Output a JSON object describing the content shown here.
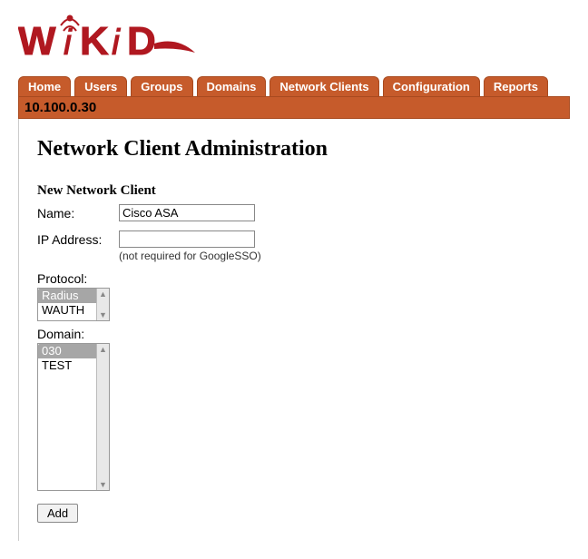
{
  "brand": {
    "name": "WiKID",
    "color": "#b01820"
  },
  "nav": {
    "tabs": [
      "Home",
      "Users",
      "Groups",
      "Domains",
      "Network Clients",
      "Configuration",
      "Reports"
    ]
  },
  "titlebar": {
    "ip": "10.100.0.30"
  },
  "main": {
    "heading": "Network Client Administration",
    "section_heading": "New Network Client",
    "rows": {
      "name": {
        "label": "Name:",
        "value": "Cisco ASA"
      },
      "ip": {
        "label": "IP Address:",
        "value": "",
        "hint": "(not required for GoogleSSO)"
      }
    },
    "protocol": {
      "label": "Protocol:",
      "options": [
        "Radius",
        "WAUTH"
      ],
      "selected": "Radius"
    },
    "domain": {
      "label": "Domain:",
      "options": [
        "030",
        "TEST"
      ],
      "selected": "030"
    },
    "add_label": "Add"
  }
}
